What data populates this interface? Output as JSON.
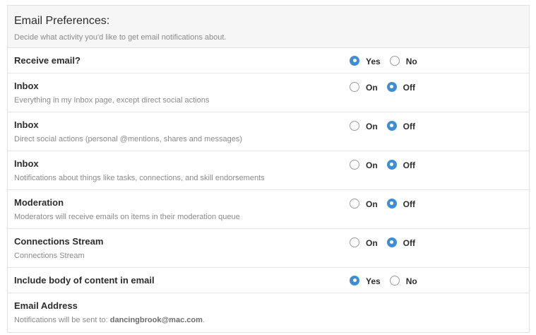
{
  "header": {
    "title": "Email Preferences:",
    "subtitle": "Decide what activity you'd like to get email notifications about."
  },
  "accent_color": "#3e8ed6",
  "rows": [
    {
      "label": "Receive email?",
      "options": [
        {
          "label": "Yes",
          "checked": true
        },
        {
          "label": "No",
          "checked": false
        }
      ]
    },
    {
      "label": "Inbox",
      "description": "Everything in my Inbox page, except direct social actions",
      "options": [
        {
          "label": "On",
          "checked": false
        },
        {
          "label": "Off",
          "checked": true
        }
      ]
    },
    {
      "label": "Inbox",
      "description": "Direct social actions (personal @mentions, shares and messages)",
      "options": [
        {
          "label": "On",
          "checked": false
        },
        {
          "label": "Off",
          "checked": true
        }
      ]
    },
    {
      "label": "Inbox",
      "description": "Notifications about things like tasks, connections, and skill endorsements",
      "options": [
        {
          "label": "On",
          "checked": false
        },
        {
          "label": "Off",
          "checked": true
        }
      ]
    },
    {
      "label": "Moderation",
      "description": "Moderators will receive emails on items in their moderation queue",
      "options": [
        {
          "label": "On",
          "checked": false
        },
        {
          "label": "Off",
          "checked": true
        }
      ]
    },
    {
      "label": "Connections Stream",
      "description": "Connections Stream",
      "options": [
        {
          "label": "On",
          "checked": false
        },
        {
          "label": "Off",
          "checked": true
        }
      ]
    },
    {
      "label": "Include body of content in email",
      "options": [
        {
          "label": "Yes",
          "checked": true
        },
        {
          "label": "No",
          "checked": false
        }
      ]
    }
  ],
  "email_row": {
    "label": "Email Address",
    "description_prefix": "Notifications will be sent to: ",
    "email": "dancingbrook@mac.com",
    "description_suffix": "."
  }
}
